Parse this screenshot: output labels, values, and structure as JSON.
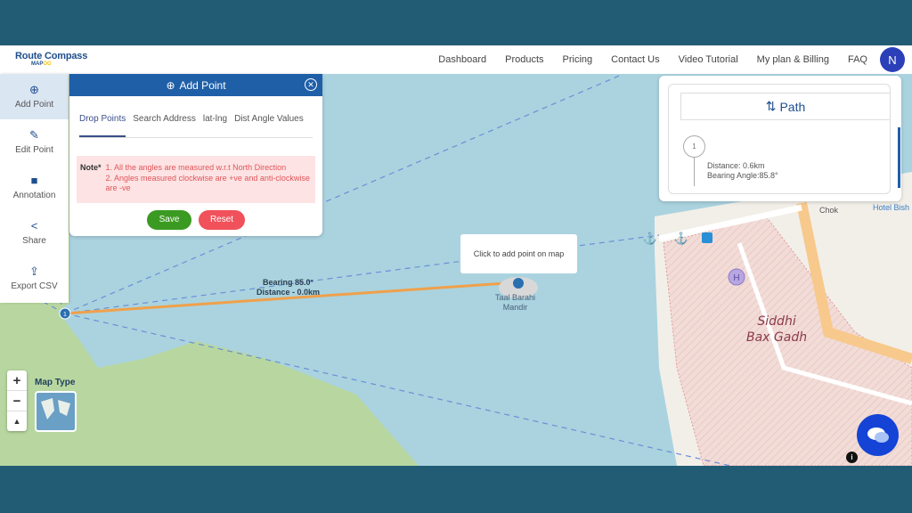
{
  "brand": {
    "name": "Route Compass",
    "sub_a": "MAP",
    "sub_b": "OG"
  },
  "nav": {
    "links": [
      "Dashboard",
      "Products",
      "Pricing",
      "Contact Us",
      "Video Tutorial",
      "My plan & Billing",
      "FAQ"
    ],
    "avatar": "N"
  },
  "sidebar": {
    "items": [
      {
        "label": "Add Point",
        "icon": "add-circle-icon",
        "active": true
      },
      {
        "label": "Edit Point",
        "icon": "pencil-icon"
      },
      {
        "label": "Annotation",
        "icon": "comment-icon"
      },
      {
        "label": "Share",
        "icon": "share-icon"
      },
      {
        "label": "Export CSV",
        "icon": "export-icon"
      }
    ]
  },
  "panel": {
    "title": "Add Point",
    "tabs": [
      "Drop Points",
      "Search Address",
      "lat-lng",
      "Dist Angle Values"
    ],
    "active_tab": "Drop Points",
    "note_label": "Note*",
    "note_lines": [
      "1. All the angles are measured w.r.t North Direction",
      "2. Angles measured clockwise are +ve and anti-clockwise are -ve"
    ],
    "save": "Save",
    "reset": "Reset"
  },
  "path_panel": {
    "title": "Path",
    "steps": [
      {
        "num": "1",
        "distance": "Distance: 0.6km",
        "bearing": "Bearing Angle:85.8°"
      }
    ]
  },
  "map": {
    "tooltip": "Click to add point on map",
    "segment_bearing": "Bearing  85.0°",
    "segment_distance": "Distance - 0.0km",
    "marker_label": "1",
    "places": {
      "temple_1": "Taal Barahi",
      "temple_2": "Mandir",
      "fort_1": "Siddhi",
      "fort_2": "Bax Gadh",
      "chok": "Chok",
      "hotel": "Hotel Bish"
    },
    "map_type_label": "Map Type",
    "zoom_in": "+",
    "zoom_out": "−",
    "reset_north": "▲",
    "info": "i"
  },
  "colors": {
    "accent": "#1f5fa8",
    "route": "#f0a04b",
    "water": "#aad3df",
    "save": "#3b9a22",
    "reset": "#f0515a"
  }
}
